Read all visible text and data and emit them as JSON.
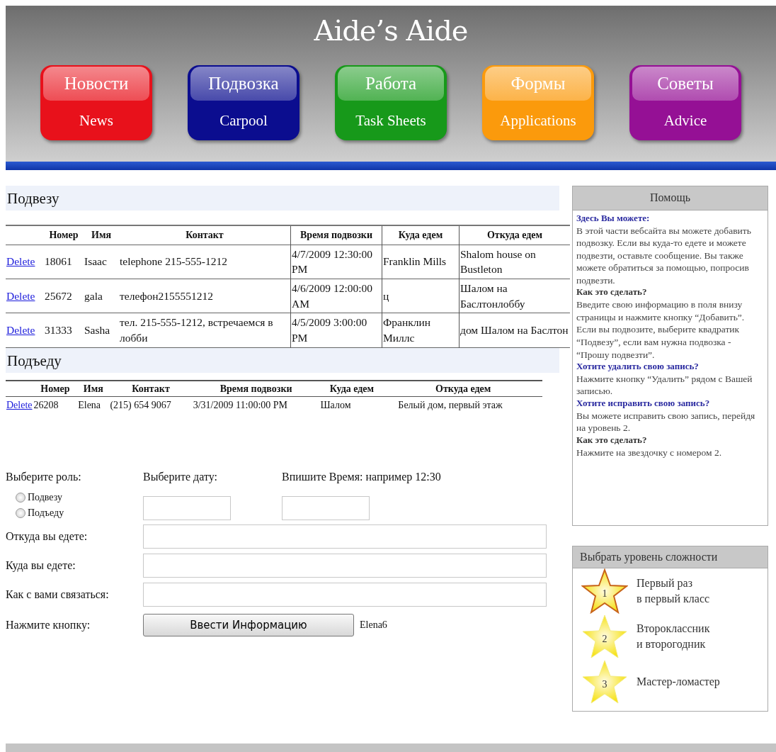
{
  "site_title": "Aide’s Aide",
  "nav": [
    {
      "label": "Новости",
      "sublabel": "News",
      "color": "#e8111b"
    },
    {
      "label": "Подвозка",
      "sublabel": "Carpool",
      "color": "#0b0d8f"
    },
    {
      "label": "Работа",
      "sublabel": "Task Sheets",
      "color": "#17991a"
    },
    {
      "label": "Формы",
      "sublabel": "Applications",
      "color": "#fb9a0c"
    },
    {
      "label": "Советы",
      "sublabel": "Advice",
      "color": "#951095"
    }
  ],
  "offers": {
    "heading": "Подвезу",
    "columns": [
      "Номер",
      "Имя",
      "Контакт",
      "Время подвозки",
      "Куда едем",
      "Откуда едем"
    ],
    "rows": [
      {
        "action": "Delete",
        "cells": [
          "18061",
          "Isaac",
          "telephone 215-555-1212",
          "4/7/2009 12:30:00 PM",
          "Franklin Mills",
          "Shalom house on Bustleton"
        ]
      },
      {
        "action": "Delete",
        "cells": [
          "25672",
          "gala",
          "телефон2155551212",
          "4/6/2009 12:00:00 AM",
          "ц",
          "Шалом на Баслтонлоббу"
        ]
      },
      {
        "action": "Delete",
        "cells": [
          "31333",
          "Sasha",
          "тел. 215-555-1212, встречаемся в лобби",
          "4/5/2009 3:00:00 PM",
          "Франклин Миллс",
          "дом Шалом на Баслтон"
        ]
      }
    ]
  },
  "requests": {
    "heading": "Подъеду",
    "columns": [
      "Номер",
      "Имя",
      "Контакт",
      "Время подвозки",
      "Куда едем",
      "Откуда едем"
    ],
    "rows": [
      {
        "action": "Delete",
        "cells": [
          "26208",
          "Elena",
          "(215) 654 9067",
          "3/31/2009 11:00:00 PM",
          "Шалом",
          "Белый дом, первый этаж"
        ]
      }
    ]
  },
  "form": {
    "role_label": "Выберите роль:",
    "roles": [
      {
        "label": "Подвезу",
        "selected": false
      },
      {
        "label": "Подъеду",
        "selected": false
      }
    ],
    "date_label": "Выберите дату:",
    "time_label": "Впишите Время: например 12:30",
    "fields": [
      {
        "label": "Откуда вы едете:"
      },
      {
        "label": "Куда вы едете:"
      },
      {
        "label": "Как с вами связаться:"
      }
    ],
    "submit_label": "Нажмите кнопку:",
    "submit_button": "Ввести Информацию",
    "user": "Elena6"
  },
  "help": {
    "title": "Помощь",
    "sections": [
      {
        "heading": "Здесь Вы можете:",
        "color": "#2a2aa0",
        "text": "В этой части вебсайта вы можете добавить подвозку. Если вы куда-то едете и можете подвезти, оставьте сообщение. Вы также можете обратиться за помощью, попросив подвезти."
      },
      {
        "heading": "Как это сделать?",
        "color": "#333333",
        "text": "Введите свою информацию в поля внизу страницы и нажмите кнопку “Добавить”. Если вы подвозите, выберите квадратик “Подвезу”, если вам нужна подвозка - “Прошу подвезти”."
      },
      {
        "heading": "Хотите удалить свою запись?",
        "color": "#2a2aa0",
        "text": "Нажмите кнопку “Удалить” рядом с Вашей записью."
      },
      {
        "heading": "Хотите исправить свою запись?",
        "color": "#2a2aa0",
        "text": "Вы можете исправить свою запись, перейдя на уровень 2."
      },
      {
        "heading": "Как это сделать?",
        "color": "#333333",
        "text": "Нажмите на звездочку с номером 2."
      }
    ]
  },
  "levels": {
    "title": "Выбрать уровень сложности",
    "items": [
      {
        "number": "1",
        "label": "Первый раз\nв первый класс",
        "selected": true
      },
      {
        "number": "2",
        "label": "Второклассник\nи второгодник",
        "selected": false
      },
      {
        "number": "3",
        "label": "Мастер-ломастер",
        "selected": false
      }
    ]
  }
}
